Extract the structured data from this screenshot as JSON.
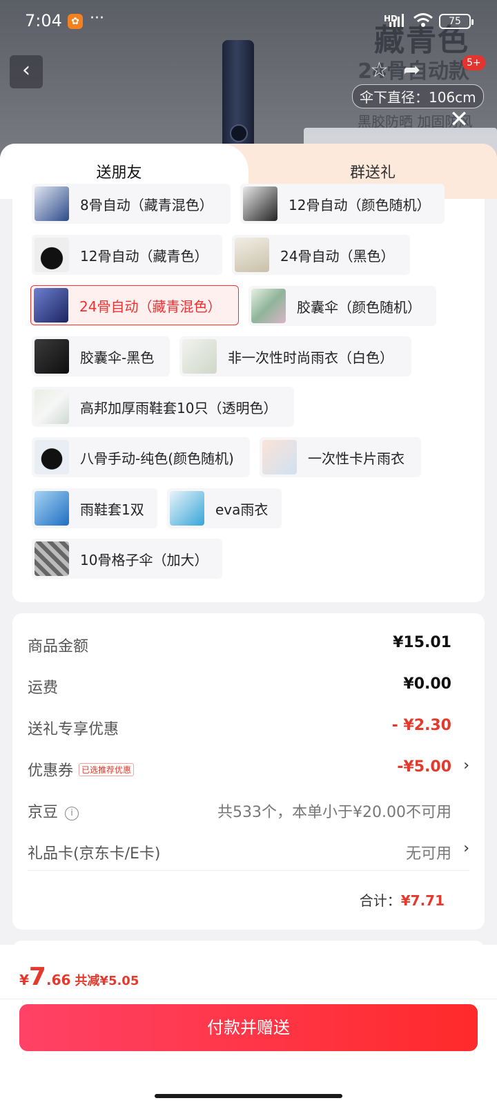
{
  "status_bar": {
    "time": "7:04",
    "signal": "HD",
    "battery": "75"
  },
  "product_banner": {
    "title": "藏青色",
    "subtitle": "24骨自动款",
    "spec": "伞下直径：106cm",
    "spec2": "黑胶防晒 加固防风",
    "badge": "5+"
  },
  "tabs": [
    {
      "label": "送朋友"
    },
    {
      "label": "群送礼"
    }
  ],
  "variants": [
    {
      "label": "8骨自动（藏青混色）"
    },
    {
      "label": "12骨自动（颜色随机）"
    },
    {
      "label": "12骨自动（藏青色）"
    },
    {
      "label": "24骨自动（黑色）"
    },
    {
      "label": "24骨自动（藏青混色）",
      "selected": true
    },
    {
      "label": "胶囊伞（颜色随机）"
    },
    {
      "label": "胶囊伞-黑色"
    },
    {
      "label": "非一次性时尚雨衣（白色）"
    },
    {
      "label": "高邦加厚雨鞋套10只（透明色）"
    },
    {
      "label": "八骨手动-纯色(颜色随机)"
    },
    {
      "label": "一次性卡片雨衣"
    },
    {
      "label": "雨鞋套1双"
    },
    {
      "label": "eva雨衣"
    },
    {
      "label": "10骨格子伞（加大）"
    }
  ],
  "summary": {
    "goods_amount": {
      "label": "商品金额",
      "value": "¥15.01"
    },
    "shipping": {
      "label": "运费",
      "value": "¥0.00"
    },
    "gift_discount": {
      "label": "送礼专享优惠",
      "value": "- ¥2.30"
    },
    "coupon": {
      "label": "优惠券",
      "tag": "已选推荐优惠",
      "value": "-¥5.00"
    },
    "jingdou": {
      "label": "京豆",
      "value": "共533个，本单小于¥20.00不可用"
    },
    "gift_card": {
      "label": "礼品卡(京东卡/E卡)",
      "value": "无可用"
    },
    "total_label": "合计：",
    "total_value": "¥7.71"
  },
  "bottom": {
    "currency": "¥",
    "price_int": "7",
    "price_dec": ".66",
    "saved": "共减¥5.05",
    "pay_button": "付款并赠送"
  },
  "colors": {
    "accent": "#f23030",
    "price_red": "#e4392c"
  }
}
